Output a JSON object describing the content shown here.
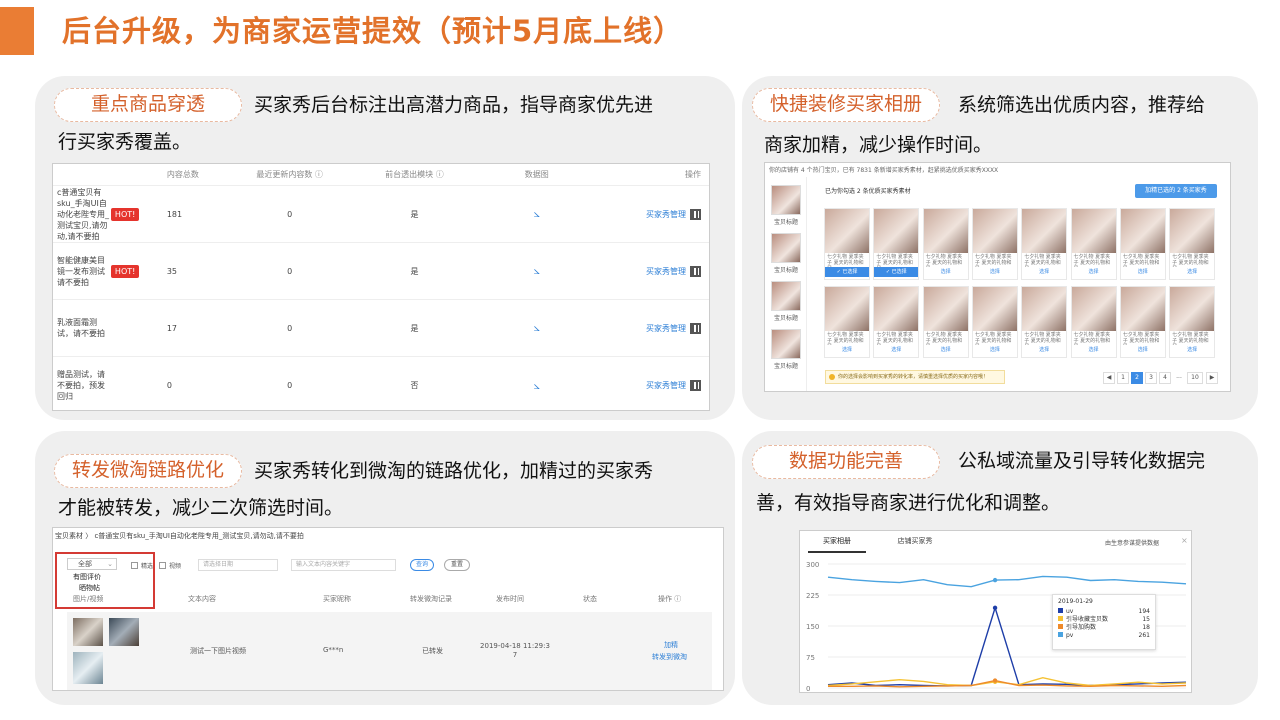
{
  "header": {
    "title": "后台升级，为商家运营提效（预计5月底上线）"
  },
  "panel1": {
    "tag": "重点商品穿透",
    "desc_line1": "买家秀后台标注出高潜力商品，指导商家优先进",
    "desc_line2": "行买家秀覆盖。",
    "table": {
      "headers": [
        "内容总数",
        "最近更新内容数 ⓘ",
        "前台透出模块 ⓘ",
        "数据图",
        "操作"
      ],
      "rows": [
        {
          "name": "c普通宝贝有sku_手淘UI自动化老陛专用_测试宝贝,请勿动,请不要拍",
          "hot": "HOT!",
          "total": "181",
          "recent": "0",
          "module": "是",
          "action": "买家秀管理"
        },
        {
          "name": "智能健康美目镜一发布测试请不要拍",
          "hot": "HOT!",
          "total": "35",
          "recent": "0",
          "module": "是",
          "action": "买家秀管理"
        },
        {
          "name": "乳液面霜测试，请不要拍",
          "hot": "",
          "total": "17",
          "recent": "0",
          "module": "是",
          "action": "买家秀管理"
        },
        {
          "name": "赠品测试，请不要拍，预发回归",
          "hot": "",
          "total": "0",
          "recent": "0",
          "module": "否",
          "action": "买家秀管理"
        }
      ]
    }
  },
  "panel2": {
    "tag": "快捷装修买家相册",
    "desc_line1": "系统筛选出优质内容，推荐给",
    "desc_line2": "商家加精，减少操作时间。",
    "shot": {
      "top_text": "你的店铺有 4 个热门宝贝，已有 7831 条新增买家秀素材，赶紧挑选优质买家秀XXXX",
      "selected_text": "已为你勾选 2 条优质买家秀素材",
      "add_button": "加精已选的 2 条买家秀",
      "side_label": "宝贝标题",
      "caption": "七夕礼物 夏季夹子 夏天的礼物和风...",
      "select_label": "选择",
      "selected_label": "✓ 已选择",
      "notice": "你的选择会影响到买家秀的转化率，请慎重选择优质的买家内容哦！",
      "pages": [
        "1",
        "2",
        "3",
        "4",
        "...",
        "10"
      ]
    }
  },
  "panel3": {
    "tag": "转发微淘链路优化",
    "desc_line1": "买家秀转化到微淘的链路优化，加精过的买家秀",
    "desc_line2": "才能被转发，减少二次筛选时间。",
    "shot": {
      "breadcrumb": "宝贝素材 〉 c普通宝贝有sku_手淘UI自动化老陛专用_测试宝贝,请勿动,请不要拍",
      "filter_all": "全部",
      "filter_opt1": "有图评价",
      "filter_opt2": "晒物帖",
      "check_jing": "精选",
      "check_video": "视频",
      "date_placeholder": "请选择日期",
      "search_placeholder": "输入文本内容关键字",
      "query_btn": "查询",
      "reset_btn": "重置",
      "headers": [
        "图片/视频",
        "文本内容",
        "买家昵称",
        "转发微淘记录",
        "发布时间",
        "状态",
        "操作 ⓘ"
      ],
      "row": {
        "text": "测试一下图片视频",
        "nick": "G***n",
        "record": "已转发",
        "time": "2019-04-18 11:29:37",
        "action1": "加精",
        "action2": "转发到微淘"
      }
    }
  },
  "panel4": {
    "tag": "数据功能完善",
    "desc_line1": "公私域流量及引导转化数据完",
    "desc_line2": "善，有效指导商家进行优化和调整。",
    "shot": {
      "tab1": "买家相册",
      "tab2": "店铺买家秀",
      "source": "由生意参谋提供数据",
      "tooltip_date": "2019-01-29",
      "legend": [
        {
          "name": "uv",
          "value": "194",
          "color": "#1e3ea8"
        },
        {
          "name": "引导收藏宝贝数",
          "value": "15",
          "color": "#f5c233"
        },
        {
          "name": "引导加购数",
          "value": "18",
          "color": "#ee8a2b"
        },
        {
          "name": "pv",
          "value": "261",
          "color": "#4aa3e0"
        }
      ]
    },
    "chart_data": {
      "type": "line",
      "yticks": [
        "300",
        "225",
        "150",
        "75",
        "0"
      ],
      "ylim": [
        0,
        300
      ],
      "series": [
        {
          "name": "pv",
          "values": [
            268,
            262,
            258,
            255,
            262,
            250,
            245,
            261,
            262,
            270,
            268,
            260,
            262,
            258,
            256,
            252
          ]
        },
        {
          "name": "uv",
          "values": [
            8,
            12,
            6,
            8,
            6,
            5,
            6,
            194,
            8,
            10,
            9,
            6,
            8,
            10,
            12,
            14
          ]
        },
        {
          "name": "引导收藏宝贝数",
          "values": [
            6,
            10,
            15,
            20,
            16,
            8,
            6,
            15,
            8,
            25,
            12,
            6,
            10,
            14,
            10,
            12
          ]
        },
        {
          "name": "引导加购数",
          "values": [
            4,
            4,
            5,
            3,
            4,
            5,
            6,
            18,
            6,
            7,
            5,
            4,
            6,
            5,
            4,
            6
          ]
        }
      ]
    }
  }
}
